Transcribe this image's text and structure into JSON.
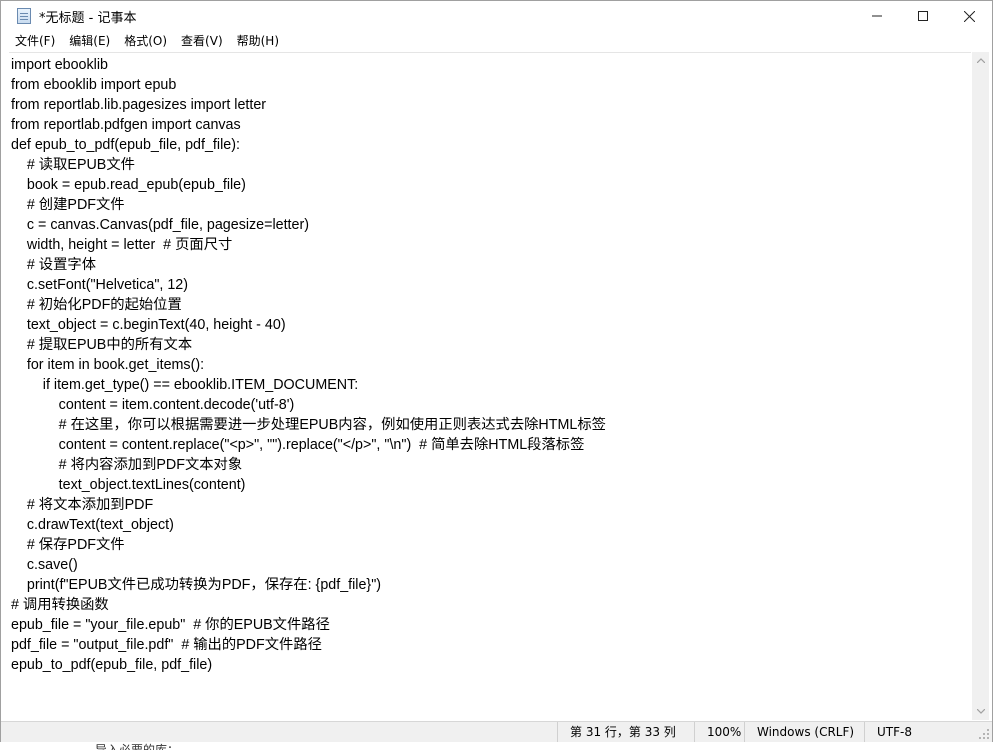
{
  "window": {
    "title": "*无标题 - 记事本",
    "controls": {
      "minimize_icon": "minimize-icon",
      "maximize_icon": "maximize-icon",
      "close_icon": "close-icon"
    }
  },
  "menu": [
    {
      "label": "文件(F)"
    },
    {
      "label": "编辑(E)"
    },
    {
      "label": "格式(O)"
    },
    {
      "label": "查看(V)"
    },
    {
      "label": "帮助(H)"
    }
  ],
  "editor": {
    "lines": [
      "import ebooklib",
      "from ebooklib import epub",
      "from reportlab.lib.pagesizes import letter",
      "from reportlab.pdfgen import canvas",
      "def epub_to_pdf(epub_file, pdf_file):",
      "    # 读取EPUB文件",
      "    book = epub.read_epub(epub_file)",
      "    # 创建PDF文件",
      "    c = canvas.Canvas(pdf_file, pagesize=letter)",
      "    width, height = letter  # 页面尺寸",
      "    # 设置字体",
      "    c.setFont(\"Helvetica\", 12)",
      "    # 初始化PDF的起始位置",
      "    text_object = c.beginText(40, height - 40)",
      "    # 提取EPUB中的所有文本",
      "    for item in book.get_items():",
      "        if item.get_type() == ebooklib.ITEM_DOCUMENT:",
      "            content = item.content.decode('utf-8')",
      "            # 在这里，你可以根据需要进一步处理EPUB内容，例如使用正则表达式去除HTML标签",
      "            content = content.replace(\"<p>\", \"\").replace(\"</p>\", \"\\n\")  # 简单去除HTML段落标签",
      "            # 将内容添加到PDF文本对象",
      "            text_object.textLines(content)",
      "    # 将文本添加到PDF",
      "    c.drawText(text_object)",
      "    # 保存PDF文件",
      "    c.save()",
      "    print(f\"EPUB文件已成功转换为PDF，保存在: {pdf_file}\")",
      "# 调用转换函数",
      "epub_file = \"your_file.epub\"  # 你的EPUB文件路径",
      "pdf_file = \"output_file.pdf\"  # 输出的PDF文件路径",
      "epub_to_pdf(epub_file, pdf_file)"
    ]
  },
  "statusbar": {
    "position": "第 31 行，第 33 列",
    "zoom": "100%",
    "line_ending": "Windows (CRLF)",
    "encoding": "UTF-8"
  },
  "background_text": "导入必要的库："
}
